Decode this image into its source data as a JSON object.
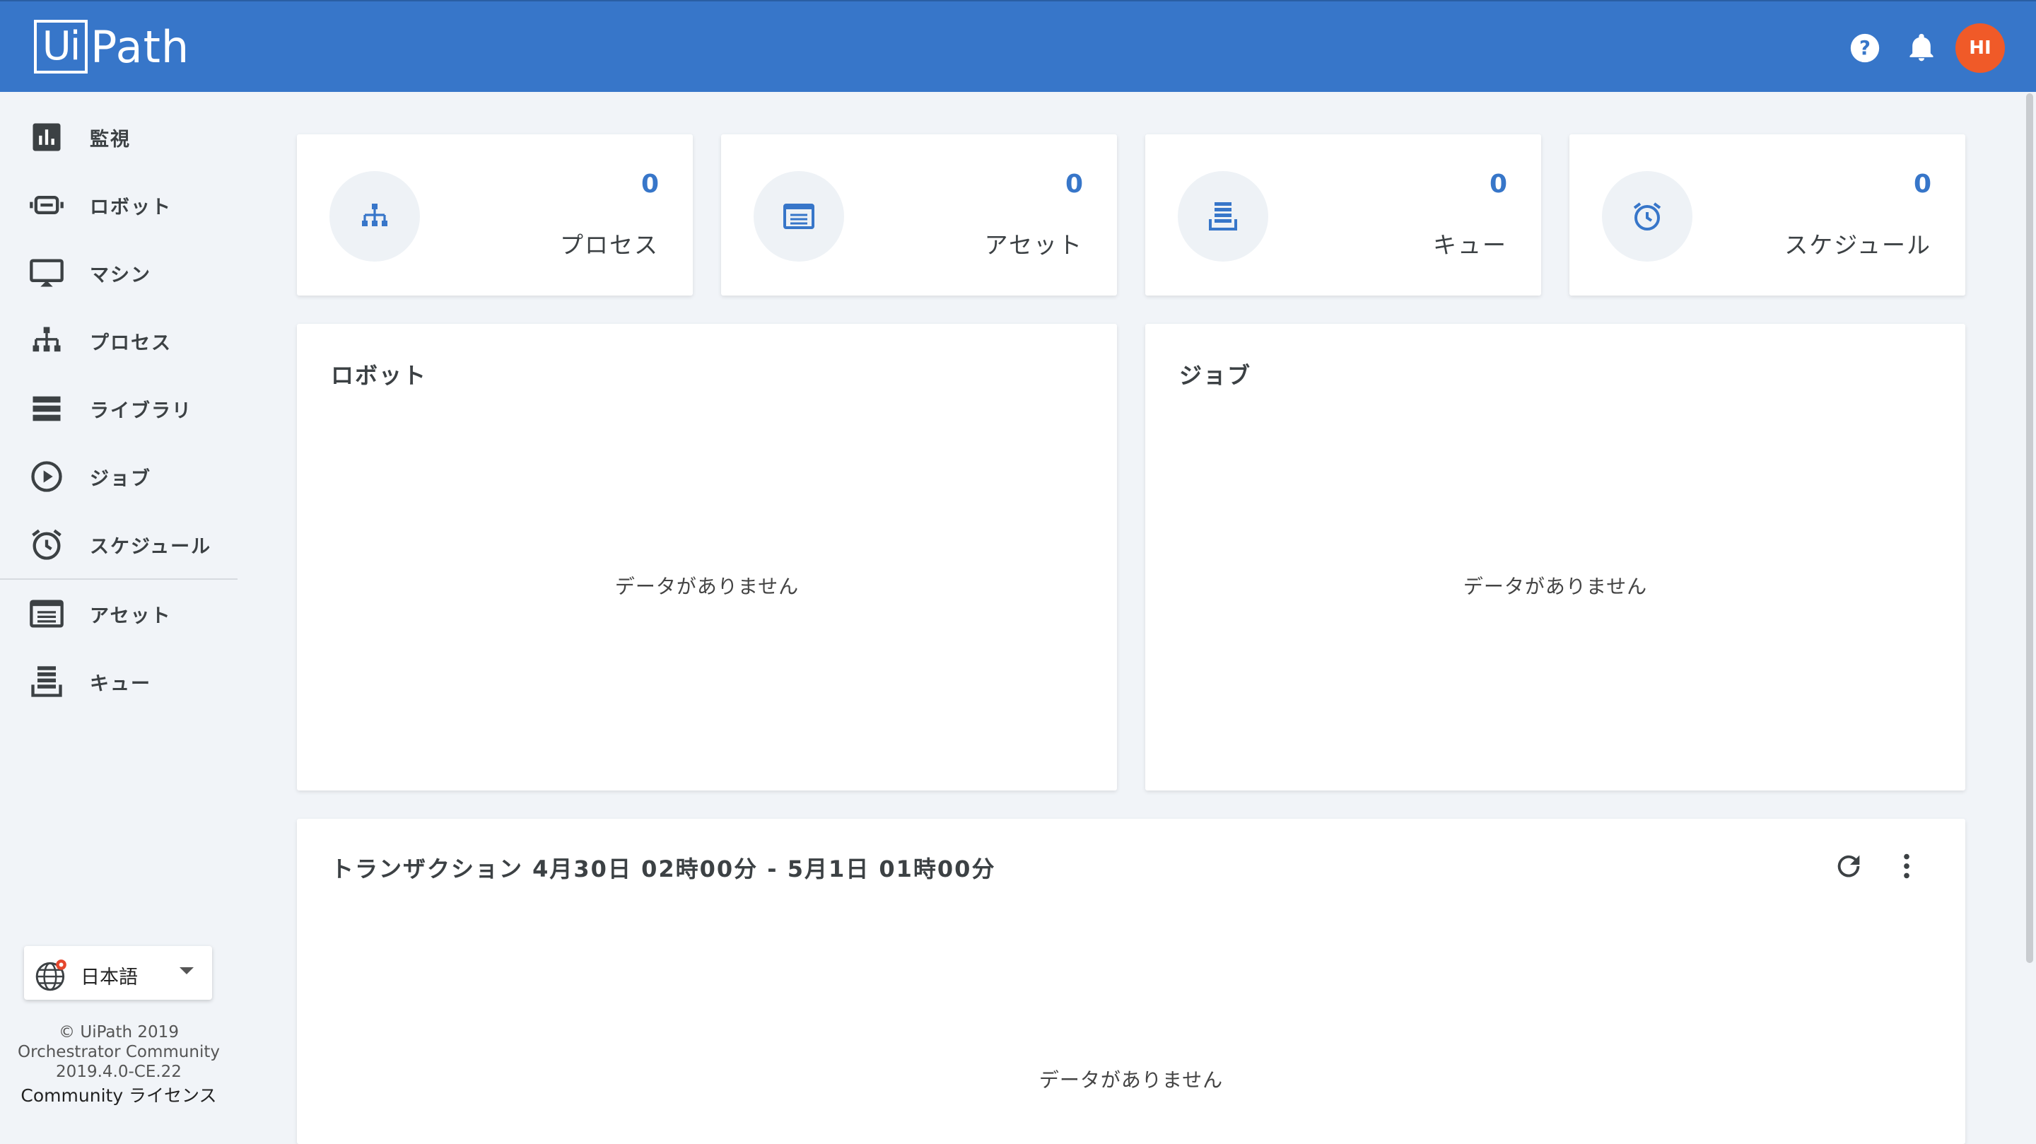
{
  "header": {
    "logo_box": "Ui",
    "logo_rest": "Path",
    "avatar_initials": "HI",
    "help_icon": "help-circle-icon",
    "bell_icon": "bell-icon",
    "color": "#3776c9"
  },
  "sidebar": {
    "items": [
      {
        "label": "監視",
        "icon": "chart-icon"
      },
      {
        "label": "ロボット",
        "icon": "robot-icon"
      },
      {
        "label": "マシン",
        "icon": "monitor-icon"
      },
      {
        "label": "プロセス",
        "icon": "process-icon"
      },
      {
        "label": "ライブラリ",
        "icon": "library-icon"
      },
      {
        "label": "ジョブ",
        "icon": "play-circle-icon"
      },
      {
        "label": "スケジュール",
        "icon": "alarm-icon"
      },
      {
        "label": "アセット",
        "icon": "asset-icon"
      },
      {
        "label": "キュー",
        "icon": "queue-icon"
      }
    ],
    "language": "日本語",
    "footer": {
      "copyright": "© UiPath 2019",
      "product": "Orchestrator Community",
      "version": "2019.4.0-CE.22",
      "license": "Community ライセンス"
    }
  },
  "stats": [
    {
      "count": "0",
      "label": "プロセス",
      "icon": "process-icon"
    },
    {
      "count": "0",
      "label": "アセット",
      "icon": "asset-icon"
    },
    {
      "count": "0",
      "label": "キュー",
      "icon": "queue-icon"
    },
    {
      "count": "0",
      "label": "スケジュール",
      "icon": "alarm-icon"
    }
  ],
  "robots_panel": {
    "title": "ロボット",
    "empty": "データがありません"
  },
  "jobs_panel": {
    "title": "ジョブ",
    "empty": "データがありません"
  },
  "transactions_panel": {
    "title": "トランザクション 4月30日 02時00分 - 5月1日 01時00分",
    "empty": "データがありません"
  }
}
